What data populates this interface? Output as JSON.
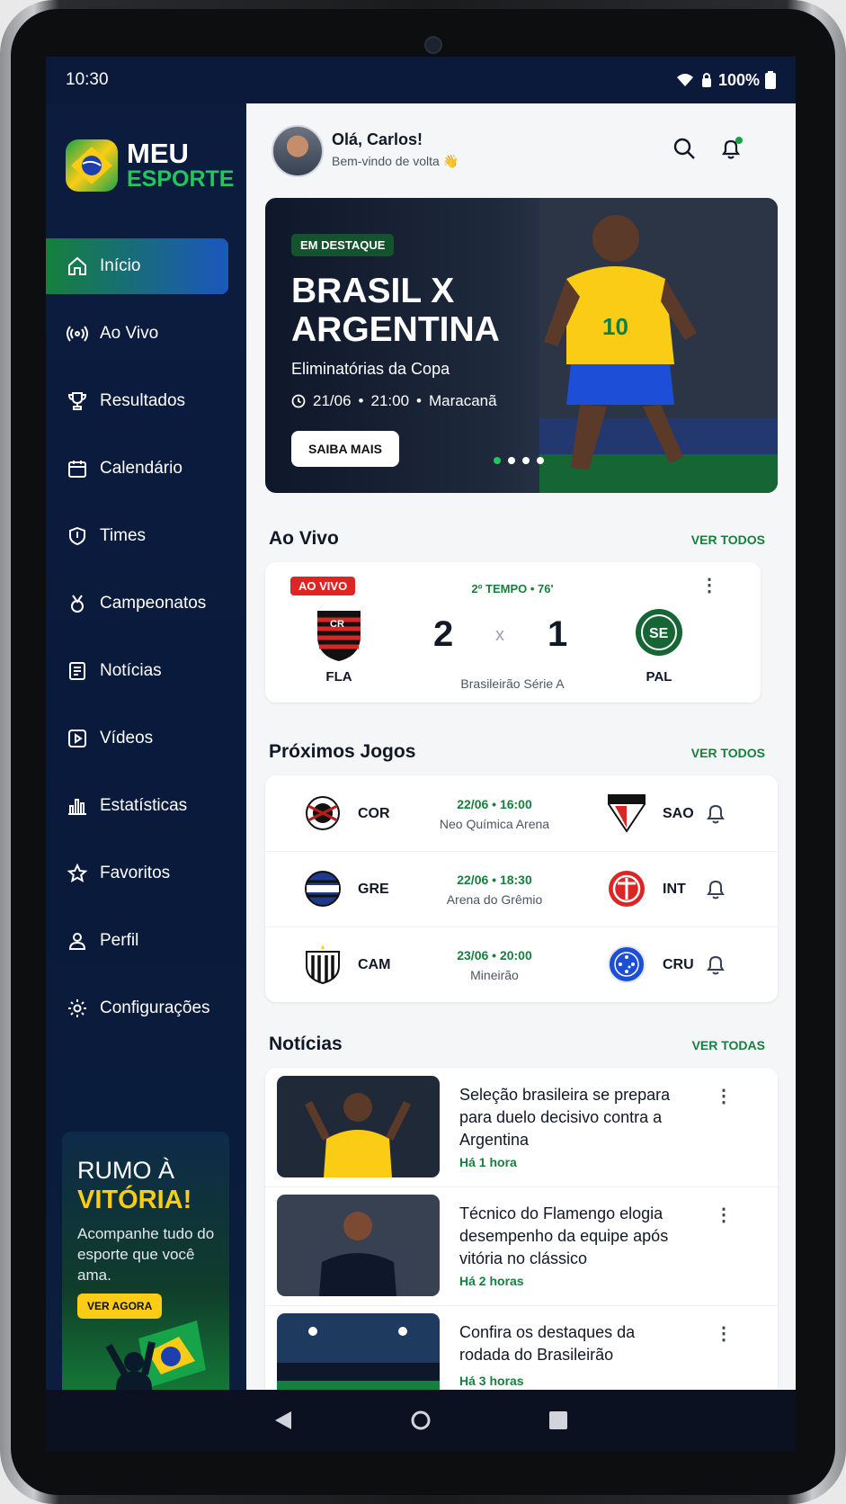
{
  "status": {
    "time": "10:30",
    "battery": "100%"
  },
  "brand": {
    "line1": "MEU",
    "line2": "ESPORTE"
  },
  "sidebar": {
    "items": [
      {
        "label": "Início",
        "icon": "home-icon"
      },
      {
        "label": "Ao Vivo",
        "icon": "broadcast-icon"
      },
      {
        "label": "Resultados",
        "icon": "trophy-icon"
      },
      {
        "label": "Calendário",
        "icon": "calendar-icon"
      },
      {
        "label": "Times",
        "icon": "shield-icon"
      },
      {
        "label": "Campeonatos",
        "icon": "medal-icon"
      },
      {
        "label": "Notícias",
        "icon": "news-icon"
      },
      {
        "label": "Vídeos",
        "icon": "video-icon"
      },
      {
        "label": "Estatísticas",
        "icon": "stats-icon"
      },
      {
        "label": "Favoritos",
        "icon": "star-icon"
      },
      {
        "label": "Perfil",
        "icon": "user-icon"
      },
      {
        "label": "Configurações",
        "icon": "gear-icon"
      }
    ],
    "promo": {
      "title1": "RUMO À",
      "title2": "VITÓRIA!",
      "description": "Acompanhe tudo do esporte que você ama.",
      "button": "VER AGORA"
    }
  },
  "header": {
    "greeting": "Olá, Carlos!",
    "subtitle": "Bem-vindo de volta 👋"
  },
  "hero": {
    "badge": "EM DESTAQUE",
    "title": "BRASIL X ARGENTINA",
    "subtitle": "Eliminatórias da Copa",
    "date": "21/06",
    "time": "21:00",
    "venue": "Maracanã",
    "button": "SAIBA MAIS",
    "slides": 4,
    "active_slide": 1
  },
  "live": {
    "title": "Ao Vivo",
    "see_all": "VER TODOS",
    "badge": "AO VIVO",
    "period": "2º TEMPO • 76'",
    "home": {
      "abbr": "FLA",
      "score": "2"
    },
    "away": {
      "abbr": "PAL",
      "score": "1"
    },
    "separator": "x",
    "league": "Brasileirão Série A"
  },
  "upcoming": {
    "title": "Próximos Jogos",
    "see_all": "VER TODOS",
    "matches": [
      {
        "home": "COR",
        "away": "SAO",
        "datetime": "22/06 • 16:00",
        "venue": "Neo Química Arena"
      },
      {
        "home": "GRE",
        "away": "INT",
        "datetime": "22/06 • 18:30",
        "venue": "Arena do Grêmio"
      },
      {
        "home": "CAM",
        "away": "CRU",
        "datetime": "23/06 • 20:00",
        "venue": "Mineirão"
      }
    ]
  },
  "news": {
    "title": "Notícias",
    "see_all": "VER TODAS",
    "items": [
      {
        "title": "Seleção brasileira se prepara para duelo decisivo contra a Argentina",
        "time": "Há 1 hora"
      },
      {
        "title": "Técnico do Flamengo elogia desempenho da equipe após vitória no clássico",
        "time": "Há 2 horas"
      },
      {
        "title": "Confira os destaques da rodada do Brasileirão",
        "time": "Há 3 horas"
      }
    ]
  },
  "colors": {
    "accent": "#15803d",
    "navy": "#0b1a3a",
    "live": "#dc2626",
    "gold": "#facc15"
  }
}
